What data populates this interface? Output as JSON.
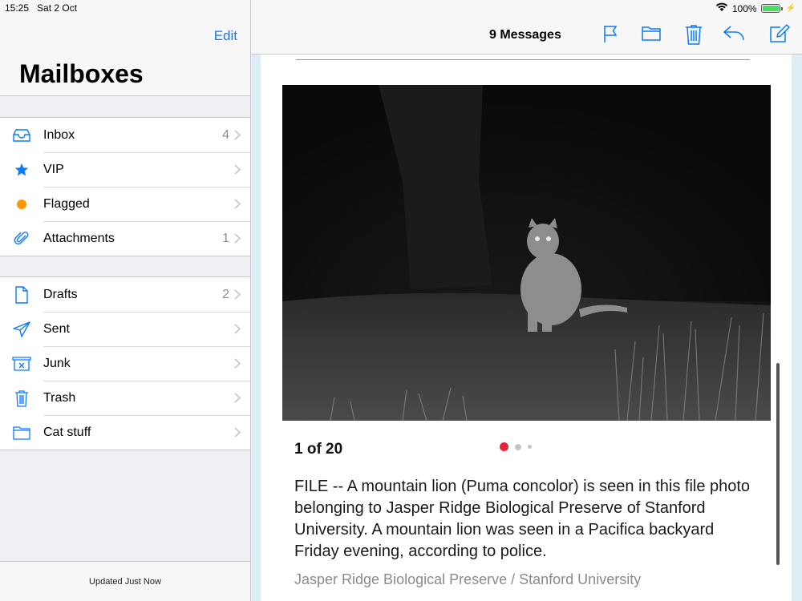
{
  "status_bar": {
    "time": "15:25",
    "date": "Sat 2 Oct",
    "battery": "100%",
    "battery_level": 1.0
  },
  "sidebar": {
    "edit_label": "Edit",
    "title": "Mailboxes",
    "group1": [
      {
        "label": "Inbox",
        "count": "4",
        "icon": "inbox-icon"
      },
      {
        "label": "VIP",
        "count": "",
        "icon": "star-icon"
      },
      {
        "label": "Flagged",
        "count": "",
        "icon": "flag-dot-icon"
      },
      {
        "label": "Attachments",
        "count": "1",
        "icon": "paperclip-icon"
      }
    ],
    "group2": [
      {
        "label": "Drafts",
        "count": "2",
        "icon": "document-icon"
      },
      {
        "label": "Sent",
        "count": "",
        "icon": "paper-plane-icon"
      },
      {
        "label": "Junk",
        "count": "",
        "icon": "junk-box-icon"
      },
      {
        "label": "Trash",
        "count": "",
        "icon": "trash-icon"
      },
      {
        "label": "Cat stuff",
        "count": "",
        "icon": "folder-icon"
      }
    ],
    "footer": "Updated Just Now"
  },
  "toolbar": {
    "title": "9 Messages",
    "icons": [
      "flag-icon",
      "folder-icon",
      "trash-icon",
      "reply-icon",
      "compose-icon"
    ]
  },
  "message": {
    "pager": "1 of 20",
    "dots_active_color": "#e8243c",
    "caption": "FILE -- A mountain lion (Puma concolor) is seen in this file photo belonging to Jasper Ridge Biological Preserve of Stanford University. A mountain lion was seen in a Pacifica backyard Friday evening, according to police.",
    "credit": "Jasper Ridge Biological Preserve / Stanford University"
  },
  "colors": {
    "accent": "#0a7aff",
    "flag_orange": "#ff9500"
  }
}
